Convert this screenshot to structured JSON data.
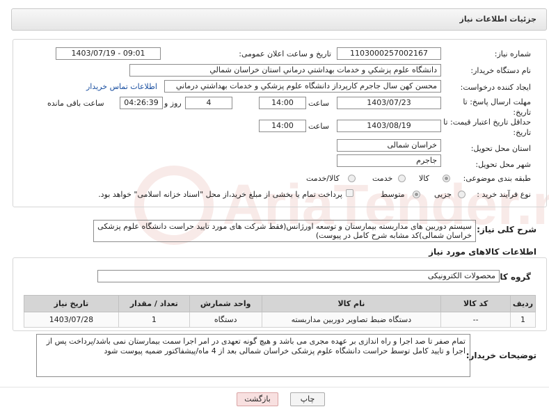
{
  "header": {
    "title": "جزئیات اطلاعات نیاز"
  },
  "fields": {
    "need_number_label": "شماره نیاز:",
    "need_number": "1103000257002167",
    "announce_label": "تاریخ و ساعت اعلان عمومی:",
    "announce_value": "1403/07/19 - 09:01",
    "buyer_label": "نام دستگاه خریدار:",
    "buyer_value": "دانشگاه علوم پزشكي و خدمات بهداشتي درماني استان خراسان شمالي",
    "creator_label": "ایجاد کننده درخواست:",
    "creator_value": "محسن کهن سال جاجرم کارپرداز دانشگاه علوم پزشكي و خدمات بهداشتي درماني",
    "contact_link": "اطلاعات تماس خریدار",
    "deadline_label": "مهلت ارسال پاسخ: تا تاریخ:",
    "deadline_date": "1403/07/23",
    "time_label": "ساعت",
    "deadline_time": "14:00",
    "days_value": "4",
    "days_label": "روز و",
    "remaining_value": "04:26:39",
    "remaining_label": "ساعت باقی مانده",
    "validity_label": "حداقل تاریخ اعتبار قیمت: تا تاریخ:",
    "validity_date": "1403/08/19",
    "validity_time": "14:00",
    "province_label": "استان محل تحویل:",
    "province_value": "خراسان شمالی",
    "city_label": "شهر محل تحویل:",
    "city_value": "جاجرم",
    "category_label": "طبقه بندی موضوعی:",
    "category_options": [
      "کالا",
      "خدمت",
      "کالا/خدمت"
    ],
    "process_label": "نوع فرآیند خرید :",
    "process_options": [
      "جزیی",
      "متوسط"
    ],
    "payment_note": "پرداخت تمام یا بخشی از مبلغ خرید،از محل \"اسناد خزانه اسلامی\" خواهد بود."
  },
  "summary": {
    "label": "شرح کلی نیاز:",
    "value": "سیستم دوربین های مداربسته بیمارستان و توسعه اورژانس(فقط شرکت های مورد تایید حراست دانشگاه علوم پزشکی خراسان شمالی)کد مشابه شرح کامل در پیوست)"
  },
  "goods": {
    "section_title": "اطلاعات کالاهای مورد نیاز",
    "group_label": "گروه کالا:",
    "group_value": "محصولات الکترونیکی",
    "columns": [
      "ردیف",
      "کد کالا",
      "نام کالا",
      "واحد شمارش",
      "تعداد / مقدار",
      "تاریخ نیاز"
    ],
    "rows": [
      [
        "1",
        "--",
        "دستگاه ضبط تصاویر دوربین مداربسته",
        "دستگاه",
        "1",
        "1403/07/28"
      ]
    ]
  },
  "notes": {
    "label": "توضیحات خریدار:",
    "value": "تمام صفر تا صد اجرا و راه اندازی بر عهده مجری می باشد و هیچ گونه تعهدی در امر اجرا سمت بیمارستان نمی باشد/پرداخت پس از اجرا و تایید کامل توسط حراست دانشگاه علوم پزشکی خراسان شمالی بعد از 4 ماه/پیشفاکتور ضمیه پیوست شود"
  },
  "buttons": {
    "print": "چاپ",
    "back": "بازگشت"
  },
  "watermark": "AriaTender.net",
  "colors": {
    "link": "#1a4fa0",
    "back_button_bg": "#f8e0e0",
    "watermark": "#c0392b"
  }
}
